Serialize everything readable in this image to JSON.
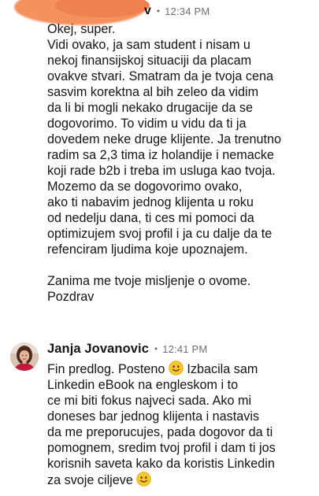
{
  "messages": [
    {
      "sender": "v",
      "dot": "•",
      "time": "12:34 PM",
      "lines": [
        "Okej, super.",
        "Vidi ovako, ja sam student i nisam u",
        "nekoj finansijskoj situaciji da placam",
        "ovakve stvari. Smatram da je tvoja cena",
        "sasvim korektna al bih zeleo da vidim",
        "da li bi mogli nekako drugacije da se",
        "dogovorimo. To vidim u vidu da ti ja",
        "dovedem neke druge klijente. Ja trenutno",
        "radim sa 2,3 tima iz holandije i nemacke",
        "koji rade b2b i treba im usluga kao tvoja.",
        "Mozemo da se dogovorimo ovako,",
        "ako ti nabavim jednog klijenta u roku",
        "od nedelju dana, ti ces mi pomoci da",
        "optimizujem svoj profil i ja cu dalje da te",
        "refenciram ljudima koje upoznajem.",
        "",
        "Zanima me tvoje misljenje o ovome.",
        "Pozdrav"
      ]
    },
    {
      "sender": "Janja Jovanovic",
      "dot": "•",
      "time": "12:41 PM",
      "line1_before_emoji": "Fin predlog. Posteno ",
      "line1_after_emoji": " Izbacila sam",
      "lines": [
        "Linkedin eBook na engleskom i to",
        "ce mi biti fokus najveci sada. Ako mi",
        "doneses bar jednog klijenta i nastavis",
        "da me preporucujes, pada dogovor da ti",
        "pomognem, sredim tvoj profil i dam ti jos",
        "korisnih saveta kako da koristis Linkedin"
      ],
      "last_line_before_emoji": "za svoje ciljeve ",
      "emoji_icon": "slightly-smiling-face-emoji"
    }
  ]
}
